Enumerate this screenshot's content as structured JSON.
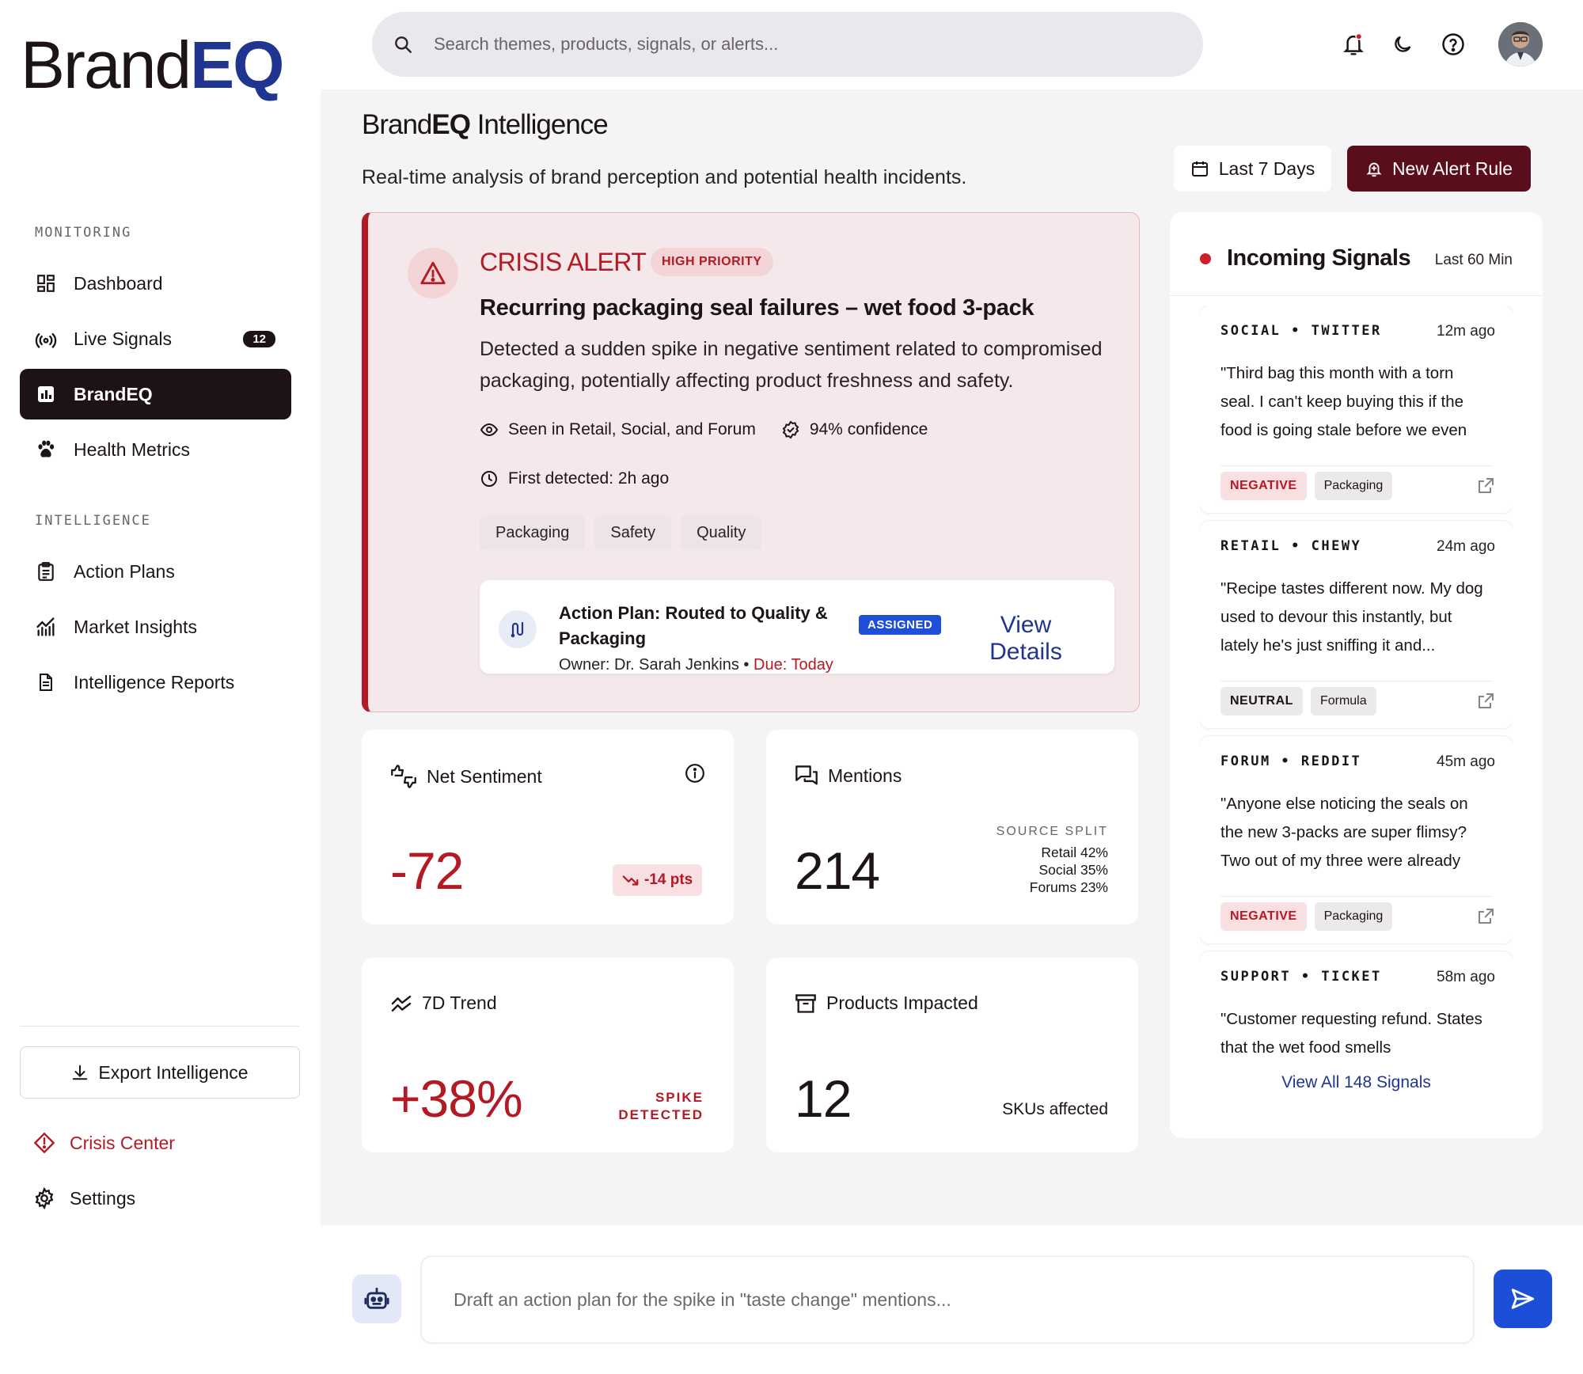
{
  "brand": {
    "name": "Brand",
    "name_accent": "EQ"
  },
  "sidebar": {
    "monitoring_label": "MONITORING",
    "intelligence_label": "INTELLIGENCE",
    "monitoring_items": [
      {
        "label": "Dashboard",
        "icon": "dashboard-icon"
      },
      {
        "label": "Live Signals",
        "icon": "signal-icon",
        "badge": "12"
      },
      {
        "label": "BrandEQ",
        "icon": "bar-chart-icon",
        "active": true
      },
      {
        "label": "Health Metrics",
        "icon": "paw-icon"
      }
    ],
    "intelligence_items": [
      {
        "label": "Action Plans",
        "icon": "clipboard-icon"
      },
      {
        "label": "Market Insights",
        "icon": "line-chart-icon"
      },
      {
        "label": "Intelligence Reports",
        "icon": "document-icon"
      }
    ],
    "export_label": "Export Intelligence",
    "crisis_center_label": "Crisis Center",
    "settings_label": "Settings"
  },
  "search": {
    "placeholder": "Search themes, products, signals, or alerts..."
  },
  "header": {
    "title_prefix": "Brand",
    "title_bold": "EQ",
    "title_suffix": " Intelligence",
    "subtitle": "Real-time analysis of brand perception and potential health incidents.",
    "date_range": "Last 7 Days",
    "new_alert_label": "New Alert Rule"
  },
  "crisis": {
    "label": "CRISIS ALERT",
    "priority": "HIGH PRIORITY",
    "title": "Recurring packaging seal failures – wet food 3-pack",
    "description": "Detected a sudden spike in negative sentiment related to compromised packaging, potentially affecting product freshness and safety.",
    "seen_in": "Seen in Retail, Social, and Forum",
    "confidence": "94% confidence",
    "first_detected": "First detected: 2h ago",
    "tags": [
      "Packaging",
      "Safety",
      "Quality"
    ],
    "plan": {
      "title": "Action Plan: Routed to Quality & Packaging",
      "owner": "Owner: Dr. Sarah Jenkins",
      "separator": " • ",
      "due": "Due: Today",
      "status": "ASSIGNED",
      "cta": "View Details"
    }
  },
  "metrics": {
    "sentiment": {
      "label": "Net Sentiment",
      "value": "-72",
      "delta": "-14 pts"
    },
    "mentions": {
      "label": "Mentions",
      "value": "214",
      "split_label": "SOURCE SPLIT",
      "split": [
        "Retail 42%",
        "Social 35%",
        "Forums 23%"
      ]
    },
    "trend": {
      "label": "7D Trend",
      "value": "+38%",
      "note_line1": "SPIKE",
      "note_line2": "DETECTED"
    },
    "products": {
      "label": "Products Impacted",
      "value": "12",
      "note": "SKUs affected"
    }
  },
  "signals": {
    "title": "Incoming Signals",
    "window": "Last 60 Min",
    "items": [
      {
        "source": "SOCIAL • TWITTER",
        "time": "12m ago",
        "quote": "\"Third bag this month with a torn seal. I can't keep buying this if the food is going stale before we even",
        "sentiment": "NEGATIVE",
        "sentiment_type": "neg",
        "category": "Packaging"
      },
      {
        "source": "RETAIL • CHEWY",
        "time": "24m ago",
        "quote": "\"Recipe tastes different now. My dog used to devour this instantly, but lately he's just sniffing it and...",
        "sentiment": "NEUTRAL",
        "sentiment_type": "neu",
        "category": "Formula"
      },
      {
        "source": "FORUM • REDDIT",
        "time": "45m ago",
        "quote": "\"Anyone else noticing the seals on the new 3-packs are super flimsy? Two out of my three were already",
        "sentiment": "NEGATIVE",
        "sentiment_type": "neg",
        "category": "Packaging"
      },
      {
        "source": "SUPPORT • TICKET",
        "time": "58m ago",
        "quote": "\"Customer requesting refund. States that the wet food smells",
        "sentiment": "",
        "sentiment_type": "neg",
        "category": ""
      }
    ],
    "view_all": "View All 148 Signals"
  },
  "chat": {
    "placeholder": "Draft an action plan for the spike in \"taste change\" mentions..."
  },
  "colors": {
    "accent_blue": "#1f3590",
    "crisis_red": "#b31a24",
    "dark": "#1d1216",
    "burgundy": "#5a0d1a",
    "send_blue": "#1d4ed8"
  }
}
